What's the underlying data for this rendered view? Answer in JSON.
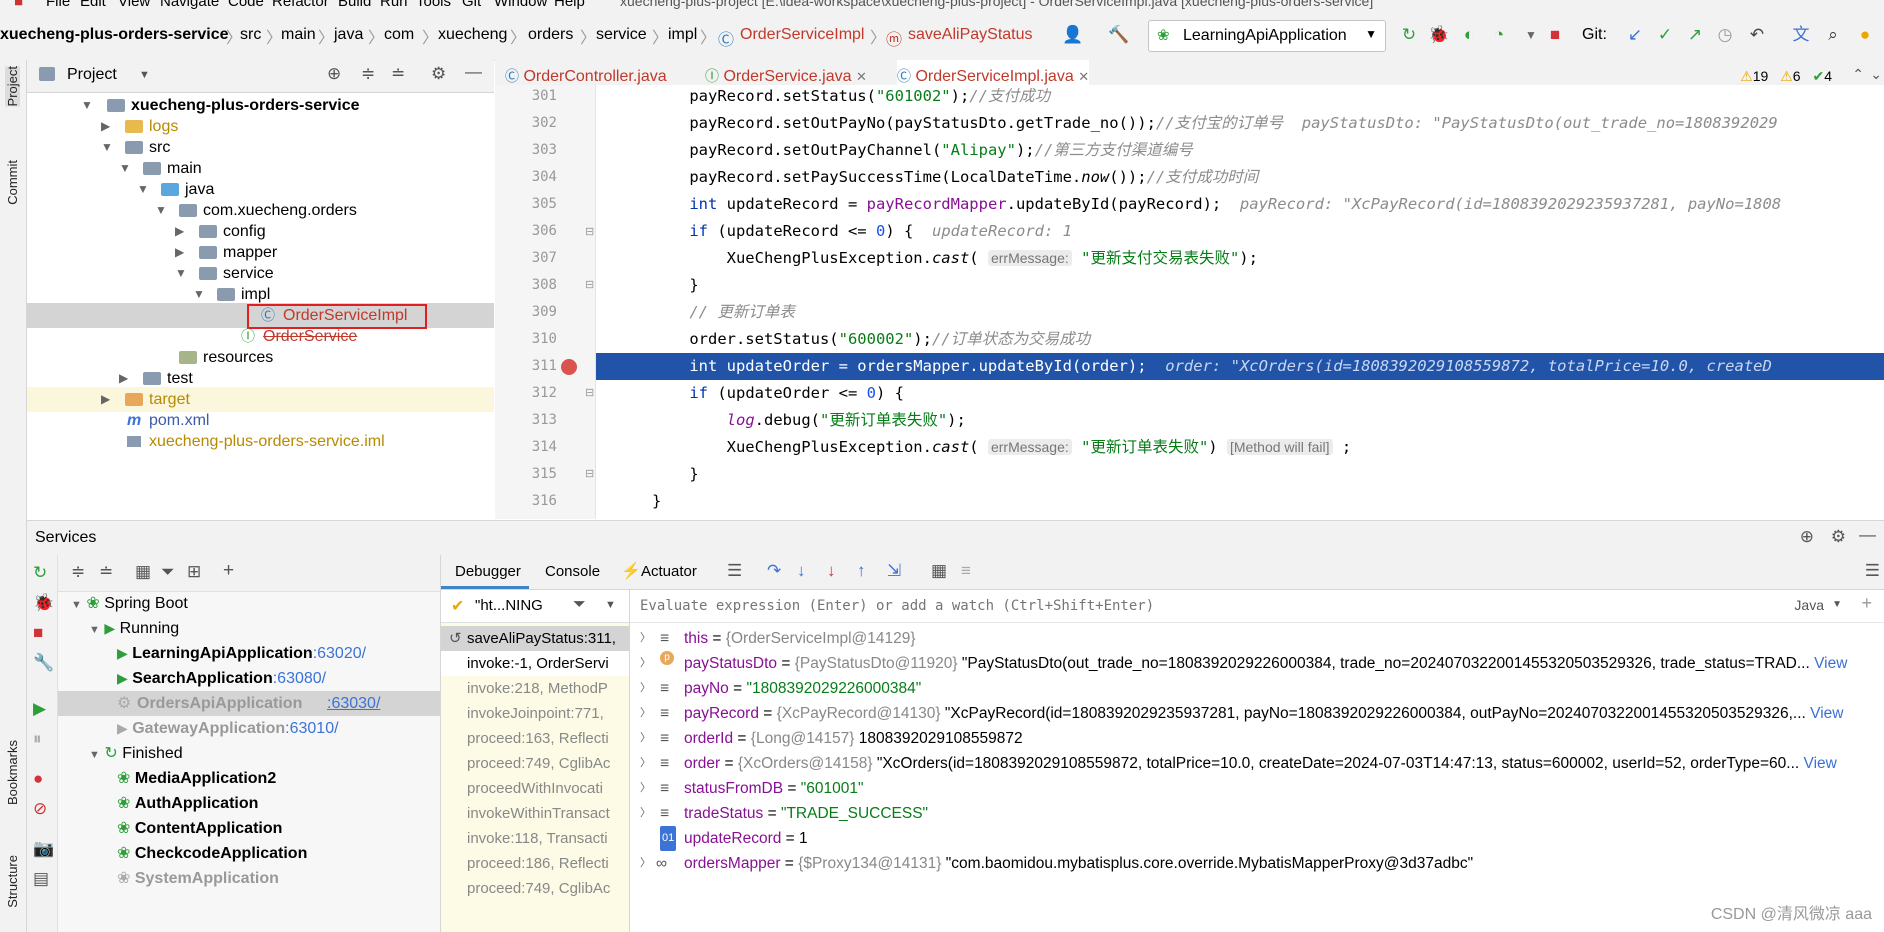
{
  "menu": {
    "items": [
      "File",
      "Edit",
      "View",
      "Navigate",
      "Code",
      "Refactor",
      "Build",
      "Run",
      "Tools",
      "Git",
      "Window",
      "Help"
    ],
    "window_title": "xuecheng-plus-project [E:\\idea-workspace\\xuecheng-plus-project] - OrderServiceImpl.java [xuecheng-plus-orders-service]"
  },
  "breadcrumbs": [
    "xuecheng-plus-orders-service",
    "src",
    "main",
    "java",
    "com",
    "xuecheng",
    "orders",
    "service",
    "impl",
    "OrderServiceImpl",
    "saveAliPayStatus"
  ],
  "toolbar": {
    "run_config": "LearningApiApplication",
    "git_label": "Git:"
  },
  "project_panel": {
    "title": "Project",
    "tree": [
      {
        "label": "xuecheng-plus-orders-service",
        "bold": true
      },
      {
        "label": "logs",
        "color": "#b88a00"
      },
      {
        "label": "src"
      },
      {
        "label": "main"
      },
      {
        "label": "java"
      },
      {
        "label": "com.xuecheng.orders"
      },
      {
        "label": "config"
      },
      {
        "label": "mapper"
      },
      {
        "label": "service"
      },
      {
        "label": "impl"
      },
      {
        "label": "OrderServiceImpl",
        "selected": true
      },
      {
        "label": "OrderService",
        "struck": true
      },
      {
        "label": "resources"
      },
      {
        "label": "test"
      },
      {
        "label": "target"
      },
      {
        "label": "pom.xml"
      },
      {
        "label": "xuecheng-plus-orders-service.iml"
      }
    ]
  },
  "editor": {
    "tabs": [
      {
        "label": "OrderController.java",
        "active": false
      },
      {
        "label": "OrderService.java",
        "active": false
      },
      {
        "label": "OrderServiceImpl.java",
        "active": true
      }
    ],
    "inspections": {
      "warnings": "19",
      "weak": "6",
      "ok": "4"
    },
    "line_numbers": [
      "301",
      "302",
      "303",
      "304",
      "305",
      "306",
      "307",
      "308",
      "309",
      "310",
      "311",
      "312",
      "313",
      "314",
      "315",
      "316"
    ],
    "current_line": "311"
  },
  "services": {
    "title": "Services",
    "tree": {
      "spring_boot": "Spring Boot",
      "running": "Running",
      "running_apps": [
        {
          "name": "LearningApiApplication",
          "port": ":63020/"
        },
        {
          "name": "SearchApplication",
          "port": ":63080/"
        },
        {
          "name": "OrdersApiApplication",
          "port": ":63030/"
        },
        {
          "name": "GatewayApplication",
          "port": ":63010/"
        }
      ],
      "finished": "Finished",
      "finished_apps": [
        "MediaApplication2",
        "AuthApplication",
        "ContentApplication",
        "CheckcodeApplication",
        "SystemApplication"
      ]
    },
    "debugger_tabs": [
      "Debugger",
      "Console",
      "Actuator"
    ],
    "thread_filter": "\"ht...NING",
    "evaluate_placeholder": "Evaluate expression (Enter) or add a watch (Ctrl+Shift+Enter)",
    "lang": "Java",
    "frames": [
      "saveAliPayStatus:311,",
      "invoke:-1, OrderServi",
      "invoke:218, MethodP",
      "invokeJoinpoint:771,",
      "proceed:163, Reflecti",
      "proceed:749, CglibAc",
      "proceedWithInvocati",
      "invokeWithinTransact",
      "invoke:118, Transacti",
      "proceed:186, Reflecti",
      "proceed:749, CglibAc"
    ],
    "variables": [
      {
        "name": "this",
        "type": "{OrderServiceImpl@14129}",
        "value": ""
      },
      {
        "name": "payStatusDto",
        "type": "{PayStatusDto@11920}",
        "value": "\"PayStatusDto(out_trade_no=1808392029226000384, trade_no=2024070322001455320503529326, trade_status=TRAD...",
        "link": "View"
      },
      {
        "name": "payNo",
        "type": "",
        "value": "\"1808392029226000384\""
      },
      {
        "name": "payRecord",
        "type": "{XcPayRecord@14130}",
        "value": "\"XcPayRecord(id=1808392029235937281, payNo=1808392029226000384, outPayNo=2024070322001455320503529326,...",
        "link": "View"
      },
      {
        "name": "orderId",
        "type": "{Long@14157}",
        "value": "1808392029108559872"
      },
      {
        "name": "order",
        "type": "{XcOrders@14158}",
        "value": "\"XcOrders(id=1808392029108559872, totalPrice=10.0, createDate=2024-07-03T14:47:13, status=600002, userId=52, orderType=60...",
        "link": "View"
      },
      {
        "name": "statusFromDB",
        "type": "",
        "value": "\"601001\""
      },
      {
        "name": "tradeStatus",
        "type": "",
        "value": "\"TRADE_SUCCESS\""
      },
      {
        "name": "updateRecord",
        "type": "",
        "value": "1"
      },
      {
        "name": "ordersMapper",
        "type": "{$Proxy134@14131}",
        "value": "\"com.baomidou.mybatisplus.core.override.MybatisMapperProxy@3d37adbc\""
      }
    ]
  },
  "left_strip": [
    "Project",
    "Commit",
    "Bookmarks",
    "Structure"
  ],
  "watermark": "CSDN @清风微凉 aaa"
}
